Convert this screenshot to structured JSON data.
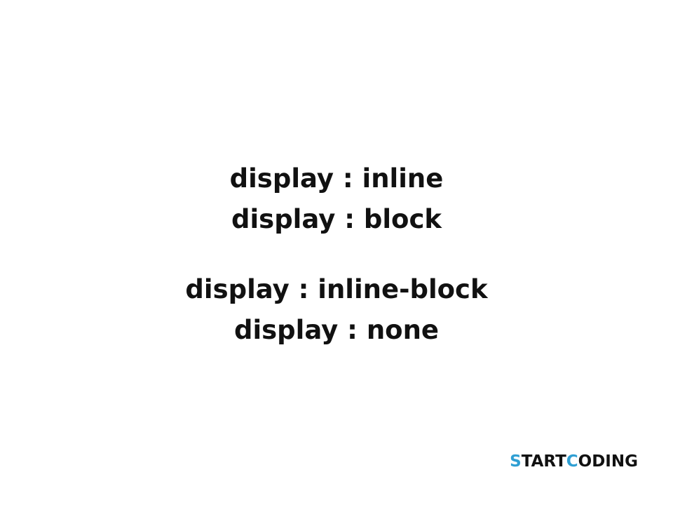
{
  "content": {
    "group_1": [
      "display : inline",
      "display : block"
    ],
    "group_2": [
      "display : inline-block",
      "display : none"
    ]
  },
  "logo": {
    "text": "STARTCODING",
    "parts": [
      "S",
      "TART",
      "C",
      "ODING"
    ],
    "accent_color": "#2f9fd3",
    "text_color": "#111111"
  }
}
